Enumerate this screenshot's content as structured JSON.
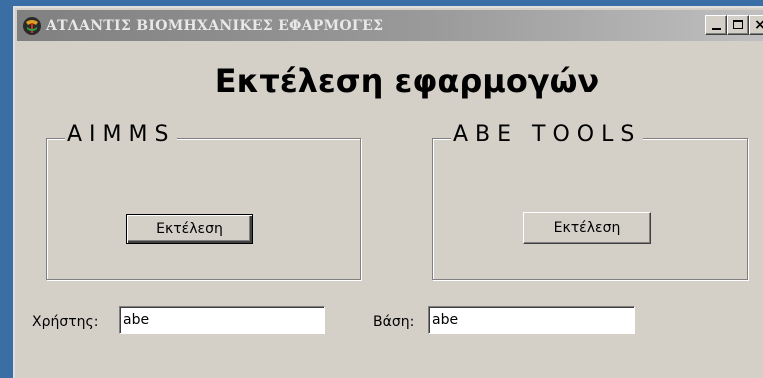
{
  "window": {
    "title": "ΑΤΛΑΝΤΙΣ ΒΙΟΜΗΧΑΝΙΚΕΣ ΕΦΑΡΜΟΓΕΣ",
    "close_glyph": "×"
  },
  "main": {
    "heading": "Εκτέλεση εφαρμογών"
  },
  "groups": [
    {
      "label": "AIMMS",
      "button_label": "Εκτέλεση"
    },
    {
      "label": "ABE TOOLS",
      "button_label": "Εκτέλεση"
    }
  ],
  "fields": {
    "user": {
      "label": "Χρήστης:",
      "value": "abe"
    },
    "database": {
      "label": "Βάση:",
      "value": "abe"
    }
  },
  "colors": {
    "desktop": "#3a6ea5",
    "window_face": "#d4d0c8",
    "title_gradient_start": "#808080",
    "title_gradient_end": "#c0c0c0"
  },
  "icons": [
    "app-logo-icon",
    "minimize-icon",
    "maximize-icon",
    "close-icon"
  ]
}
